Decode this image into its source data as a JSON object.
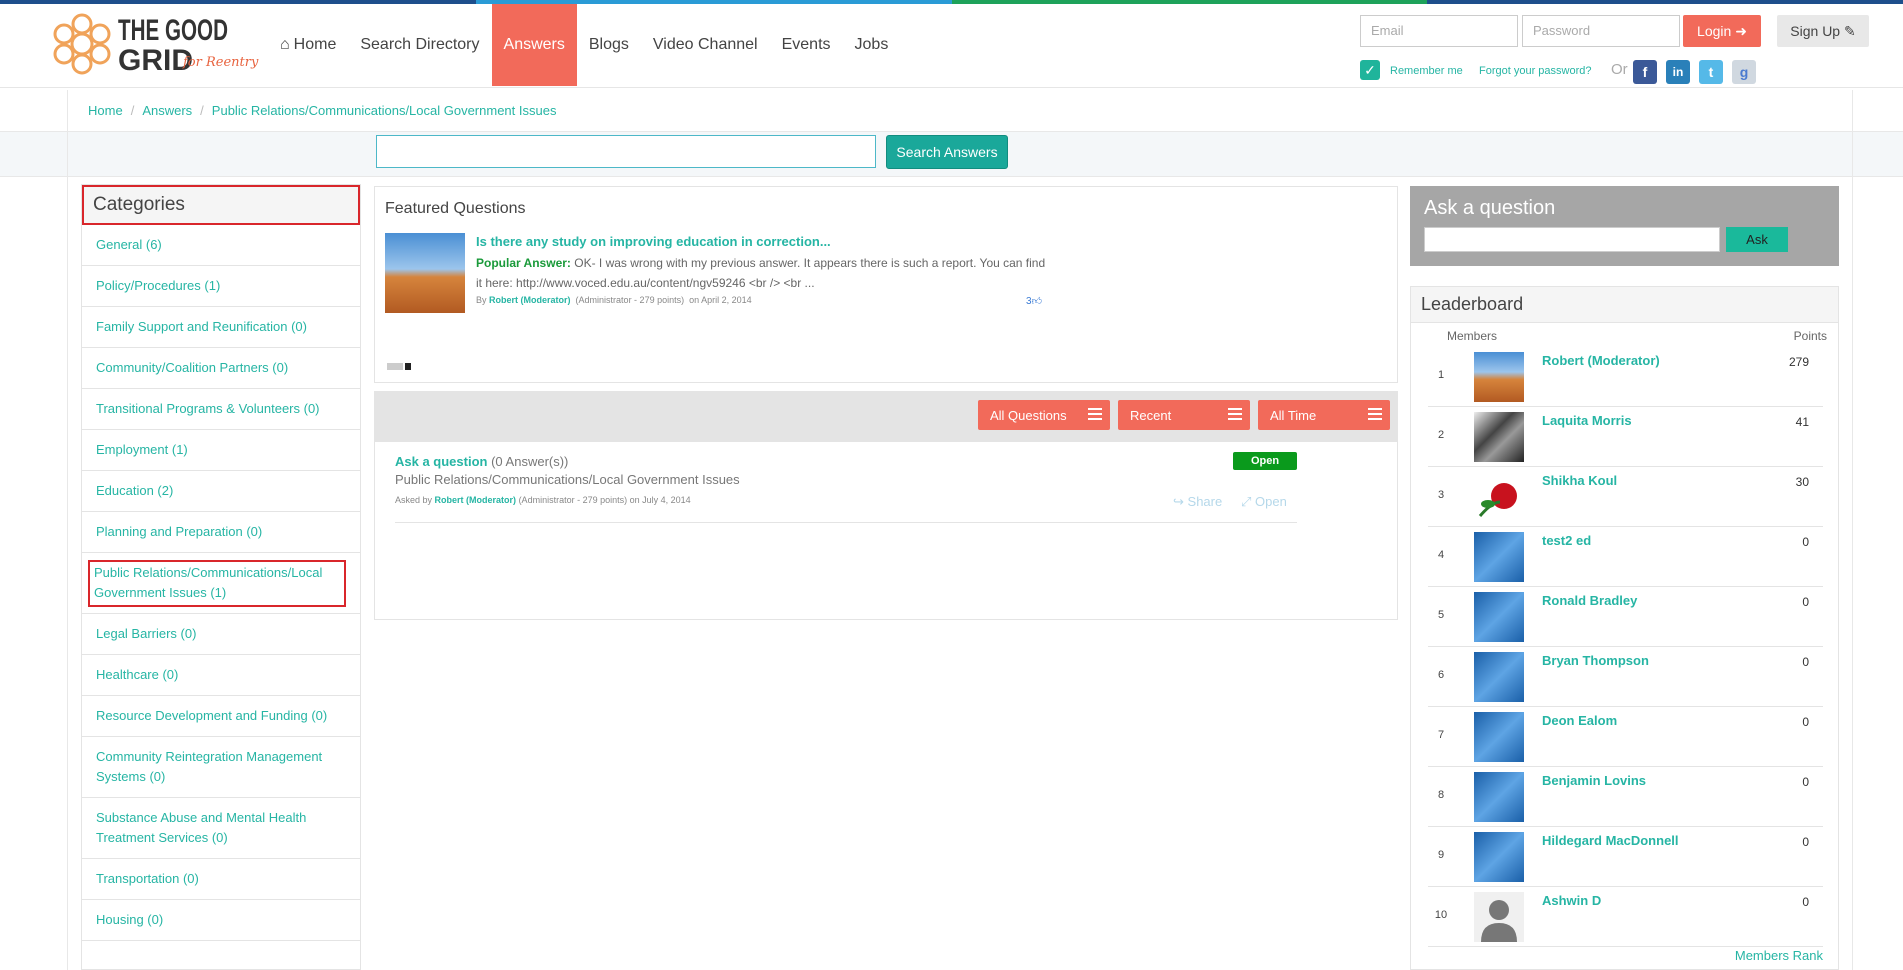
{
  "colors": {
    "accent": "#f26a5a",
    "teal": "#26b5a4",
    "topbar": [
      "#1e4f8c",
      "#2a9bd6",
      "#1ea25a",
      "#1e4f8c"
    ]
  },
  "logo": {
    "line1": "THE GOOD",
    "line2": "GRID",
    "tagline": "for Reentry"
  },
  "nav": [
    {
      "label": "Home",
      "icon": "home-icon"
    },
    {
      "label": "Search Directory"
    },
    {
      "label": "Answers",
      "active": true
    },
    {
      "label": "Blogs"
    },
    {
      "label": "Video Channel"
    },
    {
      "label": "Events"
    },
    {
      "label": "Jobs"
    }
  ],
  "login": {
    "email_placeholder": "Email",
    "password_placeholder": "Password",
    "login_label": "Login",
    "signup_label": "Sign Up",
    "remember_label": "Remember me",
    "forgot_label": "Forgot your password?",
    "or_label": "Or",
    "social": [
      "facebook",
      "linkedin",
      "twitter",
      "google"
    ]
  },
  "breadcrumb": [
    "Home",
    "Answers",
    "Public Relations/Communications/Local Government Issues"
  ],
  "search": {
    "button_label": "Search Answers"
  },
  "categories": {
    "title": "Categories",
    "items": [
      "General (6)",
      "Policy/Procedures (1)",
      "Family Support and Reunification (0)",
      "Community/Coalition Partners (0)",
      "Transitional Programs & Volunteers (0)",
      "Employment (1)",
      "Education (2)",
      "Planning and Preparation (0)",
      "Public Relations/Communications/Local Government Issues (1)",
      "Legal Barriers (0)",
      "Healthcare (0)",
      "Resource Development and Funding (0)",
      "Community Reintegration Management Systems (0)",
      "Substance Abuse and Mental Health Treatment Services (0)",
      "Transportation (0)",
      "Housing (0)"
    ]
  },
  "featured": {
    "title": "Featured Questions",
    "question": "Is there any study on improving education in correction...",
    "answer_label": "Popular Answer:",
    "answer_text": "OK- I was wrong with my previous answer. It appears there is such a report. You can find it here: http://www.voced.edu.au/content/ngv59246 <br /> <br ...",
    "by_label": "By",
    "author": "Robert (Moderator)",
    "author_info": "(Administrator - 279 points)",
    "date": "on April 2, 2014",
    "likes": "3"
  },
  "filters": [
    "All Questions",
    "Recent",
    "All Time"
  ],
  "question": {
    "title": "Ask a question",
    "answers": "(0 Answer(s))",
    "category": "Public Relations/Communications/Local Government Issues",
    "asked_by": "Asked by",
    "author": "Robert (Moderator)",
    "author_info": "(Administrator - 279 points) on July 4, 2014",
    "status": "Open",
    "share_label": "Share",
    "open_label": "Open"
  },
  "ask": {
    "title": "Ask a question",
    "button_label": "Ask"
  },
  "leaderboard": {
    "title": "Leaderboard",
    "col_members": "Members",
    "col_points": "Points",
    "rows": [
      {
        "rank": "1",
        "name": "Robert (Moderator)",
        "points": "279",
        "avatar": "canyon"
      },
      {
        "rank": "2",
        "name": "Laquita Morris",
        "points": "41",
        "avatar": "love-sculpture"
      },
      {
        "rank": "3",
        "name": "Shikha Koul",
        "points": "30",
        "avatar": "rose"
      },
      {
        "rank": "4",
        "name": "test2 ed",
        "points": "0",
        "avatar": "blue"
      },
      {
        "rank": "5",
        "name": "Ronald Bradley",
        "points": "0",
        "avatar": "blue"
      },
      {
        "rank": "6",
        "name": "Bryan Thompson",
        "points": "0",
        "avatar": "blue"
      },
      {
        "rank": "7",
        "name": "Deon Ealom",
        "points": "0",
        "avatar": "blue"
      },
      {
        "rank": "8",
        "name": "Benjamin Lovins",
        "points": "0",
        "avatar": "blue"
      },
      {
        "rank": "9",
        "name": "Hildegard MacDonnell",
        "points": "0",
        "avatar": "blue"
      },
      {
        "rank": "10",
        "name": "Ashwin D",
        "points": "0",
        "avatar": "default-user"
      }
    ],
    "more_label": "Members Rank"
  }
}
